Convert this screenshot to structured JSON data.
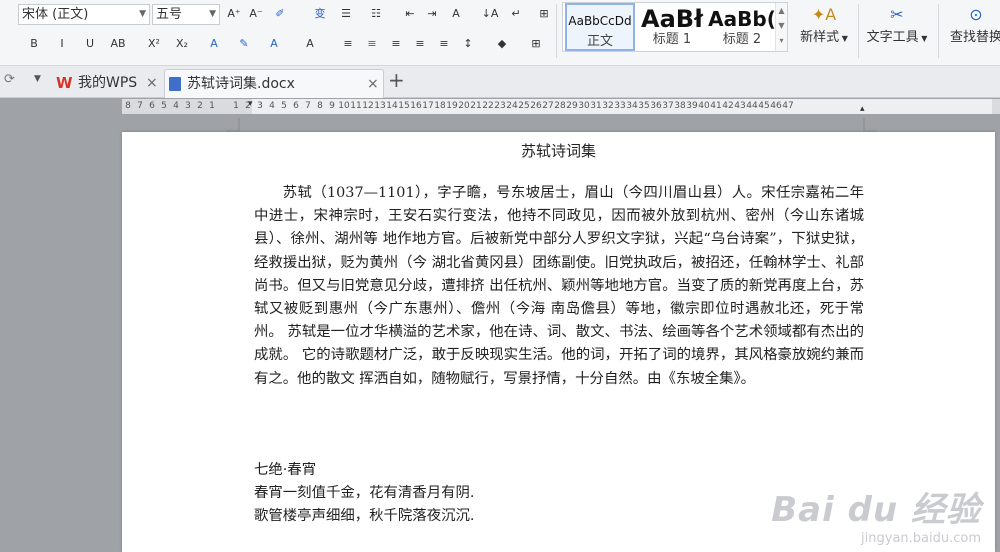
{
  "ribbon": {
    "font_name": "宋体 (正文)",
    "font_size": "五号",
    "row1_buttons": [
      {
        "name": "grow-font-button",
        "label": "A⁺"
      },
      {
        "name": "shrink-font-button",
        "label": "A⁻"
      },
      {
        "name": "clear-format-button",
        "label": "✐"
      },
      {
        "name": "pinyin-button",
        "label": "变"
      },
      {
        "name": "bullets-button",
        "label": "☰"
      },
      {
        "name": "numbering-button",
        "label": "☷"
      },
      {
        "name": "decrease-indent-button",
        "label": "⇤"
      },
      {
        "name": "increase-indent-button",
        "label": "⇥"
      },
      {
        "name": "char-format-button",
        "label": "A"
      },
      {
        "name": "sort-button",
        "label": "↓A"
      },
      {
        "name": "show-marks-button",
        "label": "↵"
      },
      {
        "name": "table-button",
        "label": "⊞"
      }
    ],
    "row2_buttons": [
      {
        "name": "bold-button",
        "label": "B"
      },
      {
        "name": "italic-button",
        "label": "I"
      },
      {
        "name": "underline-button",
        "label": "U"
      },
      {
        "name": "strikethrough-button",
        "label": "AB"
      },
      {
        "name": "superscript-button",
        "label": "X²"
      },
      {
        "name": "subscript-button",
        "label": "X₂"
      },
      {
        "name": "text-effect-button",
        "label": "A"
      },
      {
        "name": "highlight-button",
        "label": "✎"
      },
      {
        "name": "font-color-button",
        "label": "A"
      },
      {
        "name": "char-shading-button",
        "label": "A"
      },
      {
        "name": "align-left-button",
        "label": "≡"
      },
      {
        "name": "align-center-button",
        "label": "≡"
      },
      {
        "name": "align-right-button",
        "label": "≡"
      },
      {
        "name": "justify-button",
        "label": "≡"
      },
      {
        "name": "distributed-button",
        "label": "≡"
      },
      {
        "name": "line-spacing-button",
        "label": "↕"
      },
      {
        "name": "shading-button",
        "label": "◆"
      },
      {
        "name": "borders-button",
        "label": "⊞"
      }
    ],
    "styles": [
      {
        "preview": "AaBbCcDd",
        "name": "正文",
        "selected": true
      },
      {
        "preview": "AaBł",
        "name": "标题 1",
        "selected": false
      },
      {
        "preview": "AaBb(",
        "name": "标题 2",
        "selected": false
      }
    ],
    "new_style_label": "新样式",
    "text_tools_label": "文字工具",
    "find_replace_label": "查找替换"
  },
  "tabs": {
    "home_label": "我的WPS",
    "doc_label": "苏轼诗词集.docx",
    "close_glyph": "×",
    "add_glyph": "+"
  },
  "ruler": {
    "numbers": [
      "8",
      "7",
      "6",
      "5",
      "4",
      "3",
      "2",
      "1",
      "",
      "1",
      "2",
      "3",
      "4",
      "5",
      "6",
      "7",
      "8",
      "9",
      "10",
      "11",
      "12",
      "13",
      "14",
      "15",
      "16",
      "17",
      "18",
      "19",
      "20",
      "21",
      "22",
      "23",
      "24",
      "25",
      "26",
      "27",
      "28",
      "29",
      "30",
      "31",
      "32",
      "33",
      "34",
      "35",
      "36",
      "37",
      "38",
      "39",
      "40",
      "41",
      "42",
      "43",
      "44",
      "45",
      "46",
      "47"
    ]
  },
  "document": {
    "title": "苏轼诗词集",
    "paragraph": "苏轼（1037—1101），字子瞻，号东坡居士，眉山（今四川眉山县）人。宋任宗嘉祐二年中进士，宋神宗时，王安石实行变法，他持不同政见，因而被外放到杭州、密州（今山东诸城县）、徐州、湖州等 地作地方官。后被新党中部分人罗织文字狱，兴起“乌台诗案”，下狱史狱，经救援出狱，贬为黄州（今 湖北省黄冈县）团练副使。旧党执政后，被招还，任翰林学士、礼部尚书。但又与旧党意见分歧，遭排挤 出任杭州、颖州等地地方官。当变了质的新党再度上台，苏轼又被贬到惠州（今广东惠州）、儋州（今海 南岛儋县）等地，徽宗即位时遇赦北还，死于常州。 苏轼是一位才华横溢的艺术家，他在诗、词、散文、书法、绘画等各个艺术领域都有杰出的成就。 它的诗歌题材广泛，敢于反映现实生活。他的词，开拓了词的境界，其风格豪放婉约兼而有之。他的散文 挥洒自如，随物赋行，写景抒情，十分自然。由《东坡全集》。",
    "poem_title": "七绝·春宵",
    "poem_lines": [
      "春宵一刻值千金，花有清香月有阴.",
      "歌管楼亭声细细，秋千院落夜沉沉."
    ]
  },
  "watermark": {
    "brand": "Bai du 经验",
    "url": "jingyan.baidu.com"
  },
  "colors": {
    "accent": "#2b63c6",
    "wps_red": "#d6362a",
    "doc_blue": "#3f6fc9"
  }
}
